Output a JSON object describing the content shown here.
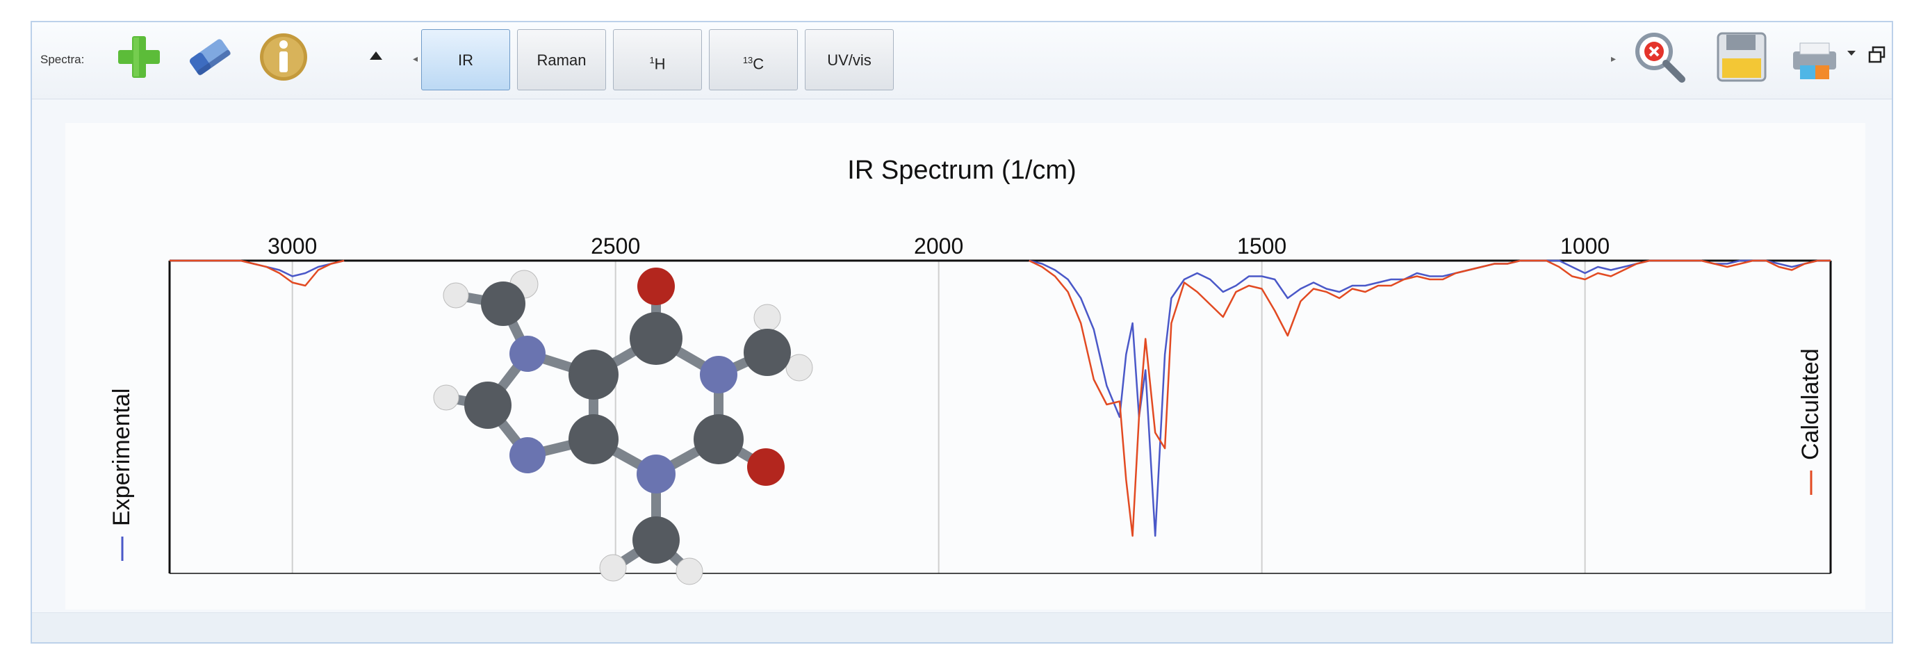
{
  "toolbar": {
    "spectra_label": "Spectra:",
    "icons": {
      "add": "plus-icon",
      "clear": "eraser-icon",
      "info": "info-icon",
      "collapse": "triangle-up-icon",
      "zoom_reset": "zoom-reset-icon",
      "save": "floppy-disk-icon",
      "print": "printer-icon",
      "restore": "restore-window-icon"
    },
    "tabs": [
      {
        "label": "IR",
        "active": true
      },
      {
        "label": "Raman",
        "active": false
      },
      {
        "label": "H",
        "sup": "1",
        "active": false
      },
      {
        "label": "C",
        "sup": "13",
        "active": false
      },
      {
        "label": "UV/vis",
        "active": false
      }
    ]
  },
  "chart_data": {
    "type": "line",
    "title": "IR Spectrum (1/cm)",
    "xlim": [
      3190,
      620
    ],
    "ylim": [
      0,
      1
    ],
    "x_ticks": [
      3000,
      2500,
      2000,
      1500,
      1000
    ],
    "grid": true,
    "left_axis_label": "Experimental",
    "right_axis_label": "Calculated",
    "series": [
      {
        "name": "Experimental",
        "color": "#4a58c8",
        "x": [
          3190,
          3120,
          3080,
          3060,
          3040,
          3020,
          3000,
          2980,
          2960,
          2940,
          2920,
          1860,
          1840,
          1820,
          1800,
          1780,
          1760,
          1740,
          1720,
          1710,
          1700,
          1690,
          1680,
          1665,
          1650,
          1640,
          1620,
          1600,
          1580,
          1560,
          1540,
          1520,
          1500,
          1480,
          1460,
          1440,
          1420,
          1400,
          1380,
          1360,
          1340,
          1320,
          1300,
          1280,
          1260,
          1240,
          1220,
          1200,
          1180,
          1160,
          1140,
          1120,
          1100,
          1080,
          1060,
          1040,
          1020,
          1000,
          980,
          960,
          940,
          920,
          900,
          880,
          860,
          840,
          820,
          800,
          780,
          760,
          740,
          720,
          700,
          680,
          660,
          640,
          620
        ],
        "y": [
          0,
          0,
          0,
          0.01,
          0.02,
          0.03,
          0.05,
          0.04,
          0.02,
          0.01,
          0,
          0,
          0.01,
          0.03,
          0.06,
          0.12,
          0.22,
          0.4,
          0.5,
          0.3,
          0.2,
          0.5,
          0.35,
          0.88,
          0.3,
          0.12,
          0.06,
          0.04,
          0.06,
          0.1,
          0.08,
          0.05,
          0.05,
          0.06,
          0.12,
          0.09,
          0.07,
          0.09,
          0.1,
          0.08,
          0.08,
          0.07,
          0.06,
          0.06,
          0.04,
          0.05,
          0.05,
          0.04,
          0.03,
          0.02,
          0.01,
          0.01,
          0,
          0,
          0,
          0,
          0.02,
          0.04,
          0.02,
          0.03,
          0.02,
          0.01,
          0,
          0,
          0,
          0,
          0,
          0.01,
          0.01,
          0,
          0,
          0,
          0.01,
          0.02,
          0.01,
          0,
          0
        ]
      },
      {
        "name": "Calculated",
        "color": "#e24a22",
        "x": [
          3190,
          3120,
          3080,
          3060,
          3040,
          3020,
          3000,
          2980,
          2960,
          2940,
          2920,
          1860,
          1840,
          1820,
          1800,
          1780,
          1760,
          1740,
          1720,
          1710,
          1700,
          1690,
          1680,
          1665,
          1650,
          1640,
          1620,
          1600,
          1580,
          1560,
          1540,
          1520,
          1500,
          1480,
          1460,
          1440,
          1420,
          1400,
          1380,
          1360,
          1340,
          1320,
          1300,
          1280,
          1260,
          1240,
          1220,
          1200,
          1180,
          1160,
          1140,
          1120,
          1100,
          1080,
          1060,
          1040,
          1020,
          1000,
          980,
          960,
          940,
          920,
          900,
          880,
          860,
          840,
          820,
          800,
          780,
          760,
          740,
          720,
          700,
          680,
          660,
          640,
          620
        ],
        "y": [
          0,
          0,
          0,
          0.01,
          0.02,
          0.04,
          0.07,
          0.08,
          0.03,
          0.01,
          0,
          0,
          0.02,
          0.05,
          0.1,
          0.2,
          0.38,
          0.46,
          0.45,
          0.7,
          0.88,
          0.5,
          0.25,
          0.55,
          0.6,
          0.2,
          0.07,
          0.1,
          0.14,
          0.18,
          0.1,
          0.08,
          0.09,
          0.16,
          0.24,
          0.13,
          0.09,
          0.1,
          0.12,
          0.09,
          0.1,
          0.08,
          0.08,
          0.06,
          0.05,
          0.06,
          0.06,
          0.04,
          0.03,
          0.02,
          0.01,
          0.01,
          0,
          0,
          0,
          0.02,
          0.05,
          0.06,
          0.04,
          0.05,
          0.03,
          0.01,
          0,
          0,
          0,
          0,
          0,
          0.01,
          0.02,
          0.01,
          0,
          0,
          0.02,
          0.03,
          0.01,
          0,
          0
        ]
      }
    ]
  },
  "molecule": {
    "colors": {
      "carbon": "#555a60",
      "nitrogen": "#6a74b0",
      "oxygen": "#b3261e",
      "hydrogen": "#e8e8e8"
    }
  }
}
